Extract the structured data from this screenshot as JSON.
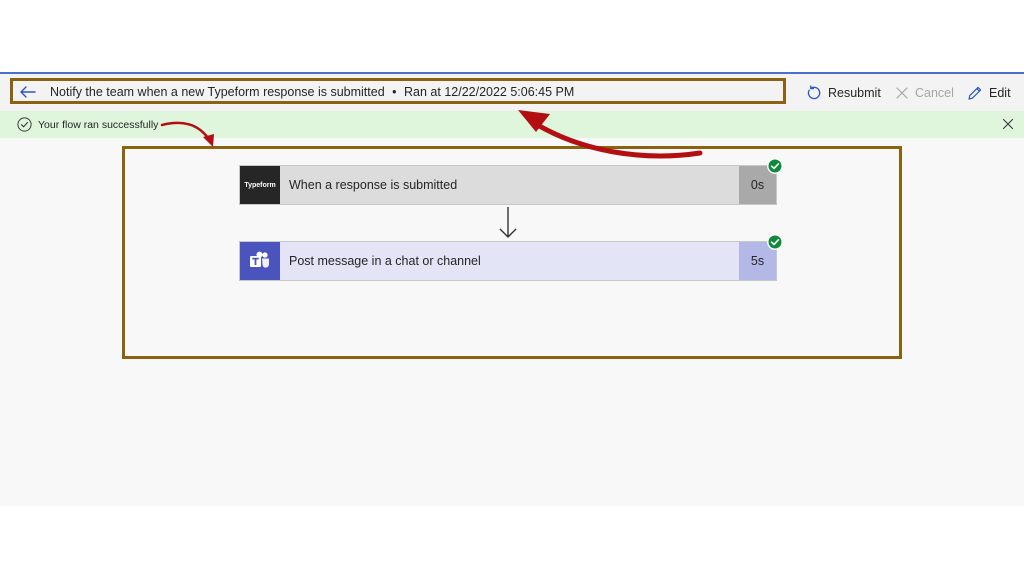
{
  "header": {
    "title": "Notify the team when a new Typeform response is submitted",
    "separator": "•",
    "run_info": "Ran at 12/22/2022 5:06:45 PM",
    "commands": {
      "resubmit": "Resubmit",
      "cancel": "Cancel",
      "edit": "Edit"
    }
  },
  "status": {
    "message": "Your flow ran successfully"
  },
  "flow": {
    "steps": [
      {
        "label": "When a response is submitted",
        "duration": "0s",
        "icon": "typeform-logo",
        "icon_text": "Typeform",
        "status": "succeeded"
      },
      {
        "label": "Post message in a chat or channel",
        "duration": "5s",
        "icon": "teams-logo",
        "status": "succeeded"
      }
    ]
  },
  "colors": {
    "accent": "#4a6fd0",
    "success_bar": "#dff6dd",
    "success_check": "#0f8a3c",
    "annotation_frame": "#8a6212",
    "annotation_arrow": "#b30f12",
    "teams": "#4b53bc",
    "typeform": "#262627"
  }
}
